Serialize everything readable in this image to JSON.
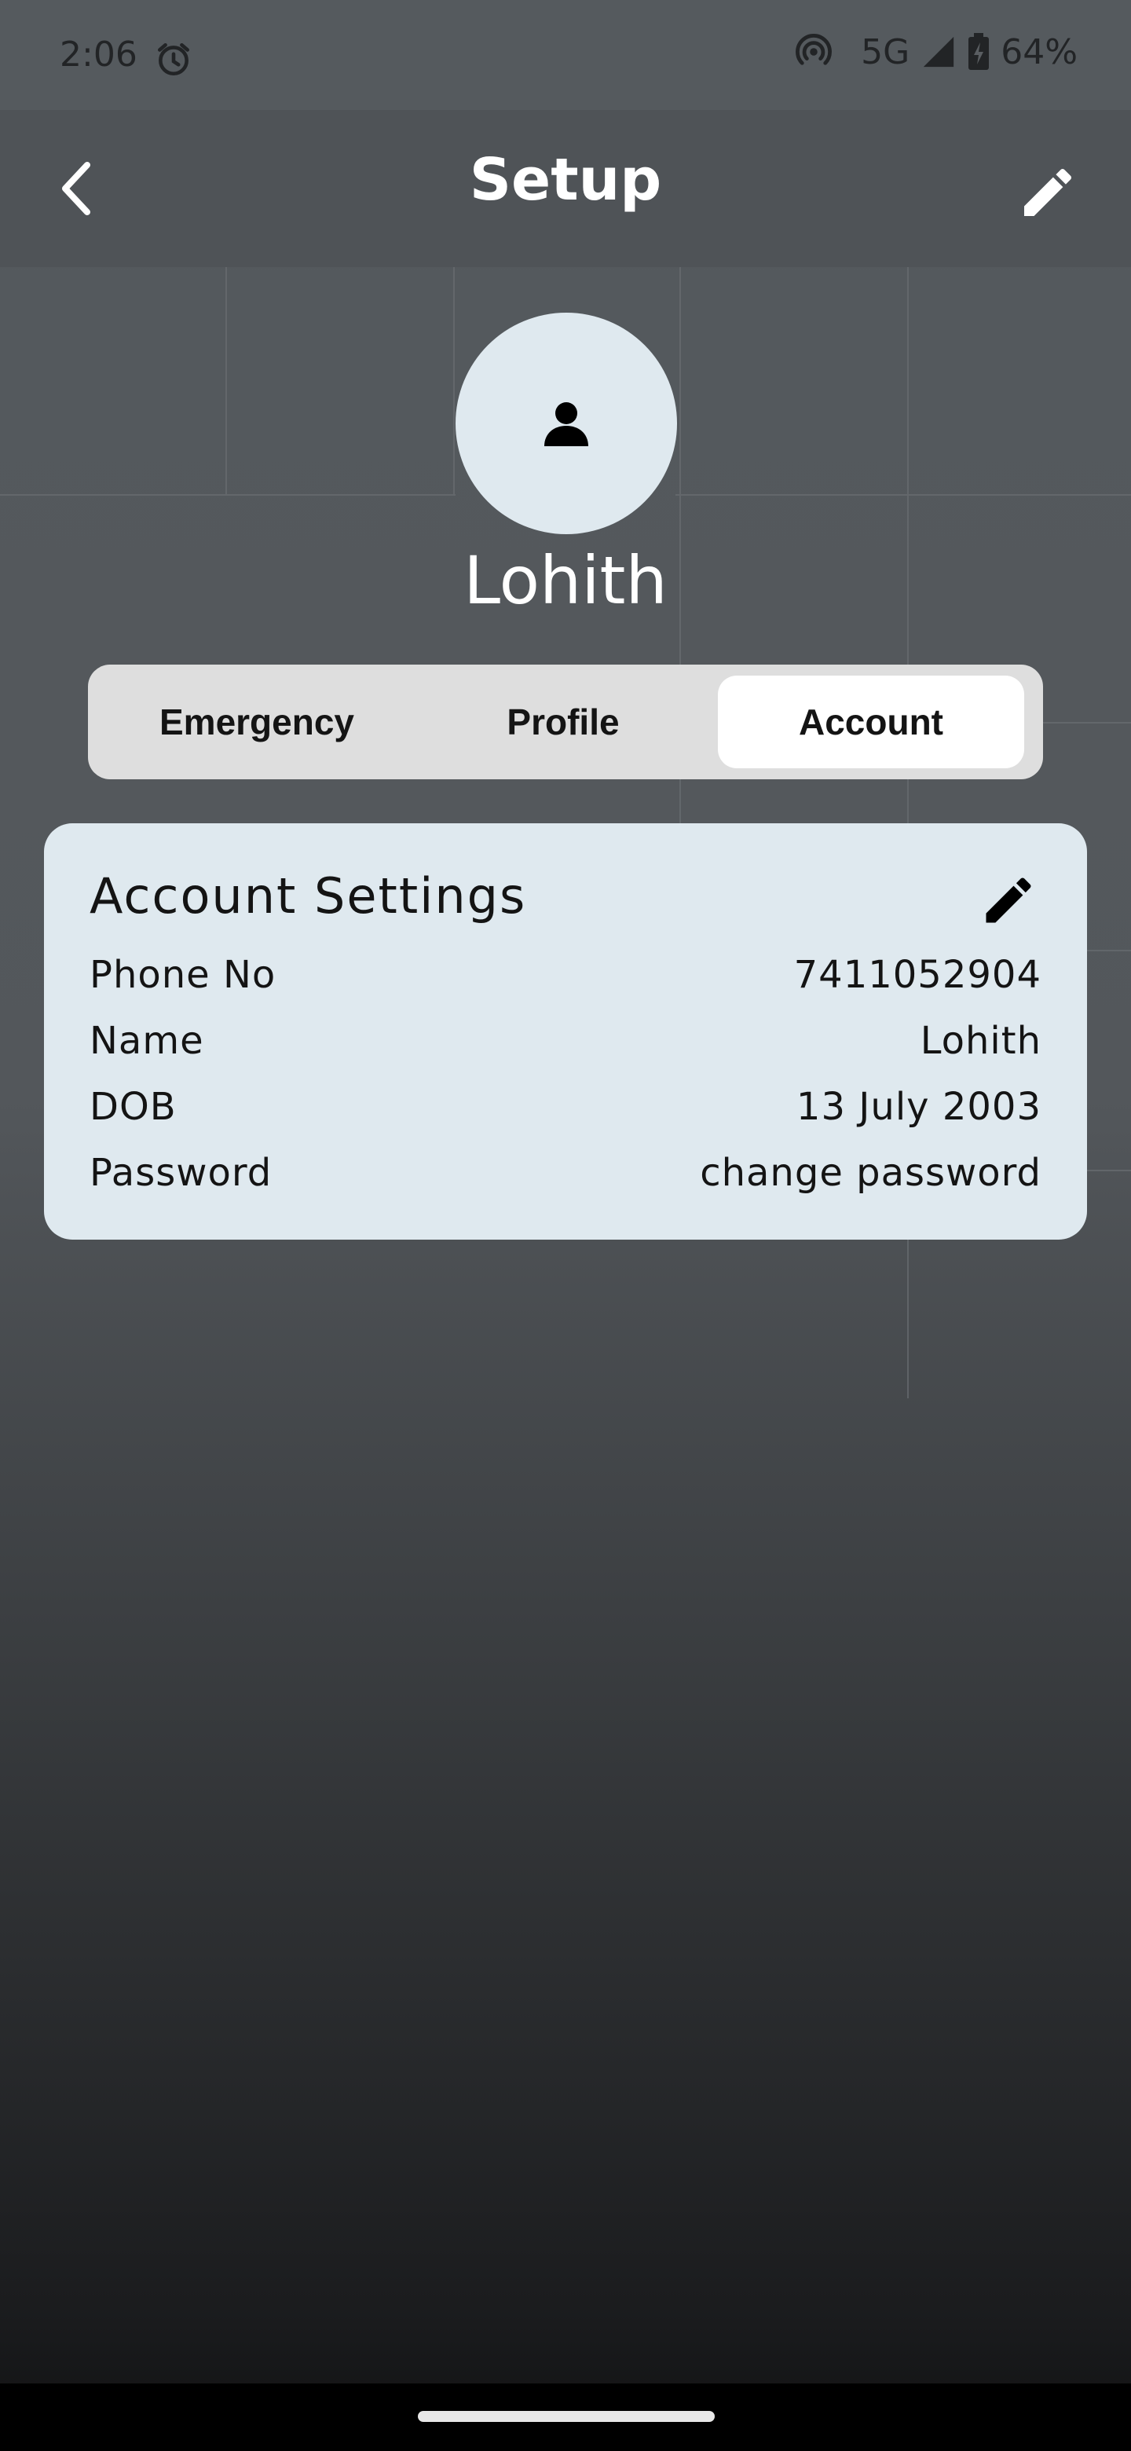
{
  "status_bar": {
    "time": "2:06",
    "network": "5G",
    "battery": "64%",
    "icons": [
      "alarm-icon",
      "hotspot-icon",
      "signal-icon",
      "battery-charging-icon"
    ]
  },
  "header": {
    "title": "Setup",
    "back_icon": "chevron-left-icon",
    "edit_icon": "pencil-icon"
  },
  "profile": {
    "name": "Lohith",
    "avatar_icon": "person-icon"
  },
  "tabs": [
    {
      "label": "Emergency",
      "active": false
    },
    {
      "label": "Profile",
      "active": false
    },
    {
      "label": "Account",
      "active": true
    }
  ],
  "account_settings": {
    "title": "Account Settings",
    "edit_icon": "pencil-icon",
    "rows": [
      {
        "label": "Phone No",
        "value": "7411052904"
      },
      {
        "label": "Name",
        "value": "Lohith"
      },
      {
        "label": "DOB",
        "value": "13 July 2003"
      },
      {
        "label": "Password",
        "value": "change password"
      }
    ]
  },
  "colors": {
    "appbar": "#4f5357",
    "card": "#dfe9ef",
    "tab_track": "#dedede",
    "tab_active": "#ffffff"
  }
}
